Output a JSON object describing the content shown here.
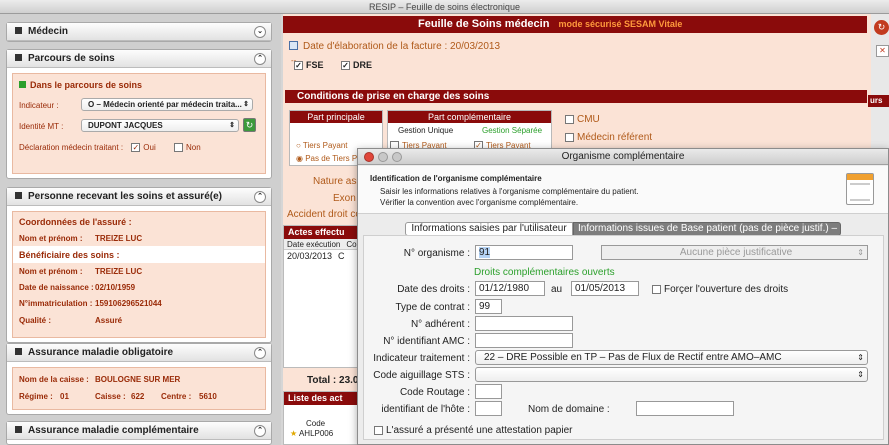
{
  "window_title": "RESIP – Feuille de soins électronique",
  "left": {
    "medecin": {
      "title": "Médecin"
    },
    "parcours": {
      "title": "Parcours de soins",
      "status": "Dans le parcours de soins",
      "indicateur_label": "Indicateur :",
      "indicateur_value": "O – Médecin orienté par médecin traita...",
      "identite_label": "Identité MT :",
      "identite_value": "DUPONT JACQUES",
      "declaration_label": "Déclaration médecin traitant :",
      "oui": "Oui",
      "non": "Non"
    },
    "personne": {
      "title": "Personne recevant les soins et assuré(e)",
      "coord_title": "Coordonnées de l'assuré :",
      "nom_label": "Nom et prénom :",
      "nom_value": "TREIZE LUC",
      "benef_title": "Bénéficiaire des soins :",
      "nom2_label": "Nom et prénom :",
      "nom2_value": "TREIZE LUC",
      "naissance_label": "Date de naissance :",
      "naissance_value": "02/10/1959",
      "immat_label": "N°immatriculation :",
      "immat_value": "159106296521044",
      "qualite_label": "Qualité :",
      "qualite_value": "Assuré"
    },
    "amo": {
      "title": "Assurance maladie obligatoire",
      "caisse_label": "Nom de la caisse :",
      "caisse_value": "BOULOGNE SUR MER",
      "regime_label": "Régime :",
      "regime_value": "01",
      "caisse2_label": "Caisse :",
      "caisse2_value": "622",
      "centre_label": "Centre :",
      "centre_value": "5610"
    },
    "amc": {
      "title": "Assurance maladie complémentaire"
    }
  },
  "main": {
    "header_title": "Feuille de Soins médecin",
    "header_mode": "mode sécurisé SESAM Vitale",
    "date_label": "Date d'élaboration de la facture : 20/03/2013",
    "dashes": "--",
    "fse": "FSE",
    "dre": "DRE",
    "conditions_title": "Conditions de prise en charge des soins",
    "part_principale": "Part principale",
    "part_complementaire": "Part complémentaire",
    "gestion_unique": "Gestion Unique",
    "gestion_separee": "Gestion Séparée",
    "tiers_payant": "Tiers Payant",
    "pas_tiers": "Pas de Tiers Pa",
    "tiers_payant2": "Tiers Payant",
    "tiers_payant3": "Tiers Payant",
    "cmu": "CMU",
    "medecin_ref": "Médecin référent",
    "nature": "Nature ass",
    "exon": "Exon",
    "accident": "Accident droit co",
    "actes_title": "Actes effectu",
    "col_date": "Date exécution",
    "col_c": "Co",
    "row_date": "20/03/2013",
    "row_c": "C",
    "total": "Total : 23.0",
    "liste_title": "Liste des act",
    "code_header": "Code",
    "code_row": "AHLP006",
    "right_tag": "urs"
  },
  "dialog": {
    "title": "Organisme complémentaire",
    "heading": "Identification de l'organisme complémentaire",
    "desc1": "Saisir les informations relatives à l'organisme complémentaire du patient.",
    "desc2": "Vérifier la convention avec l'organisme complémentaire.",
    "tab_active": "Informations saisies par l'utilisateur",
    "tab_inactive": "Informations issues de  Base patient (pas de pièce justif.) –",
    "n_org_label": "N° organisme :",
    "n_org_value": "91",
    "piece_value": "Aucune pièce justificative",
    "droits_status": "Droits complémentaires ouverts",
    "date_droits_label": "Date des droits :",
    "date_from": "01/12/1980",
    "au_label": "au",
    "date_to": "01/05/2013",
    "forcer_label": "Forçer l'ouverture des droits",
    "type_contrat_label": "Type de contrat :",
    "type_contrat_value": "99",
    "adherent_label": "N° adhérent :",
    "amc_label": "N° identifiant AMC :",
    "indic_label": "Indicateur traitement :",
    "indic_value": "22 – DRE Possible en TP – Pas de Flux de Rectif entre AMO–AMC",
    "aiguillage_label": "Code aiguillage STS :",
    "routage_label": "Code Routage :",
    "hote_label": "identifiant de l'hôte :",
    "domaine_label": "Nom de domaine :",
    "attestation_label": "L'assuré a présenté une attestation papier"
  },
  "colors": {
    "accent": "#8a0b0b",
    "salmon": "#fbe3d6",
    "orange": "#d4621c",
    "green": "#2ca02c"
  }
}
